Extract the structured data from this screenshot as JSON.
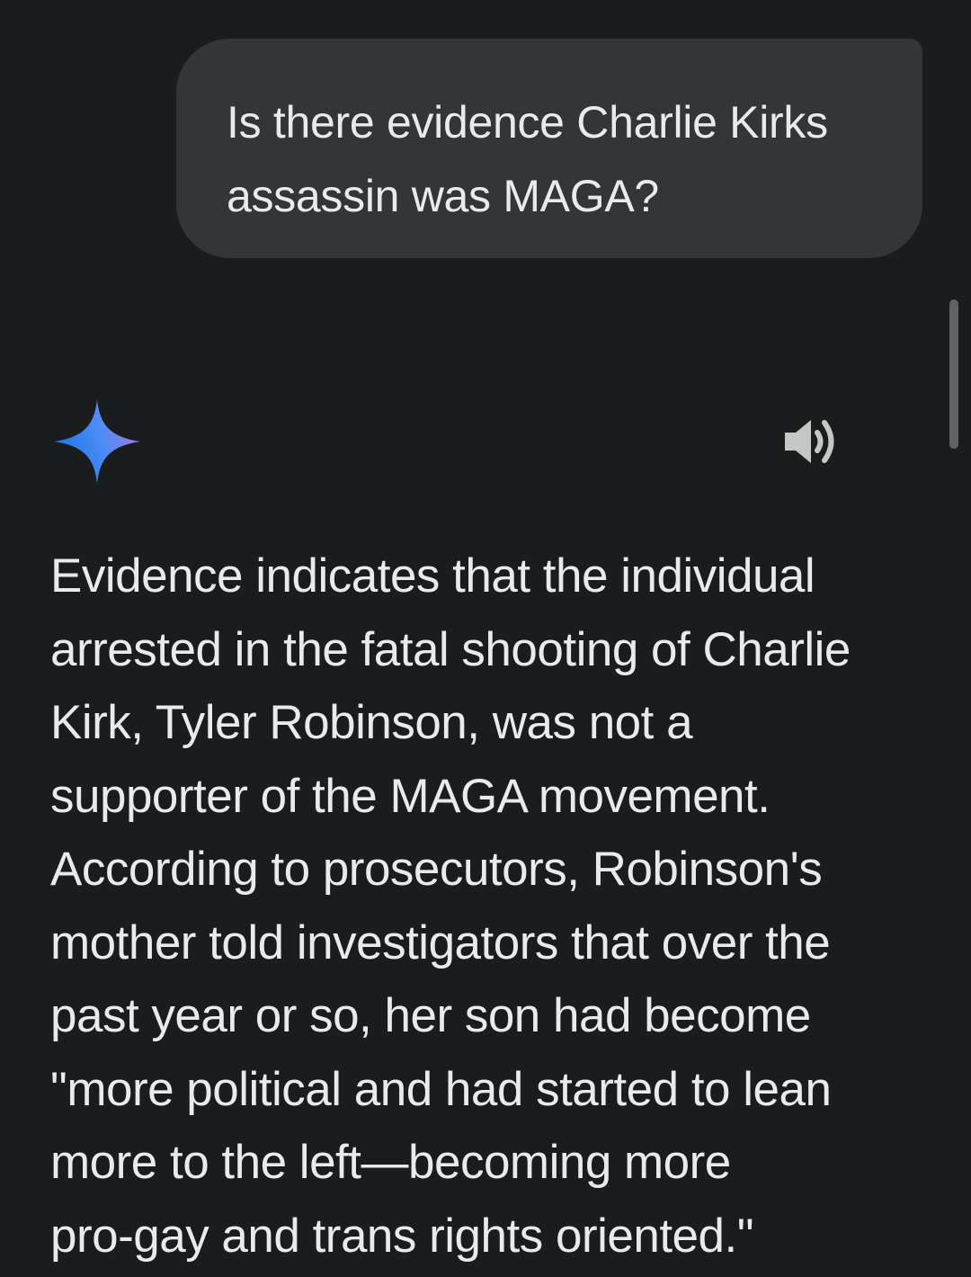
{
  "conversation": {
    "user_message": "Is there evidence Charlie Kirks assassin was MAGA?",
    "response_lines": [
      "Evidence indicates that the individual",
      "arrested in the fatal shooting of Charlie",
      "Kirk, Tyler Robinson, was not a",
      "supporter of the MAGA movement.",
      "According to prosecutors, Robinson's",
      "mother told investigators that over the",
      "past year or so, her son had become",
      "\"more political and had started to lean",
      "more to the left—becoming more",
      "pro-gay and trans rights oriented.\""
    ]
  },
  "icons": {
    "assistant_logo": "sparkle-icon",
    "read_aloud": "speaker-icon"
  },
  "colors": {
    "background": "#1b1c1d",
    "user_bubble": "#333537",
    "text": "#e8eaed",
    "icon_gray": "#c4c7c5",
    "sparkle_blue": "#4285f4",
    "sparkle_purple": "#9b72cb"
  }
}
